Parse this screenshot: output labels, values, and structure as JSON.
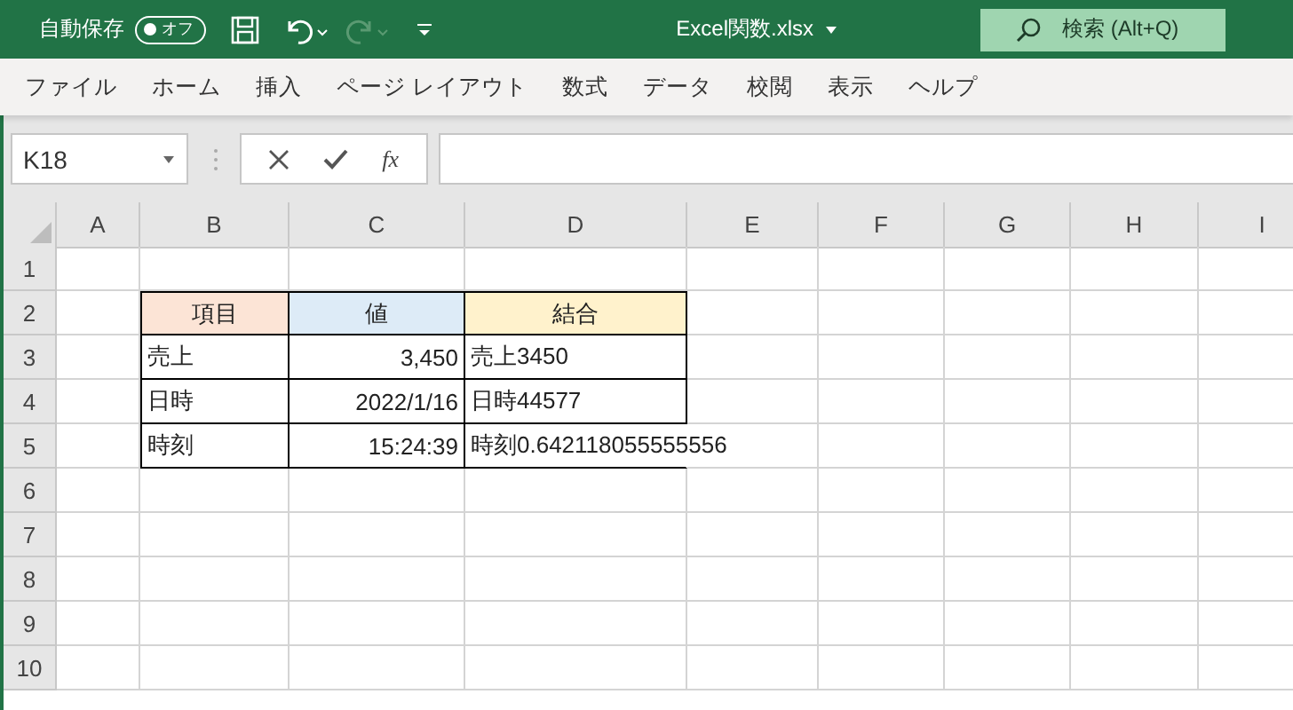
{
  "title_bar": {
    "autosave_label": "自動保存",
    "autosave": {
      "label": "オフ",
      "on": false
    },
    "file_name": "Excel関数.xlsx",
    "search": {
      "placeholder": "検索 (Alt+Q)"
    }
  },
  "ribbon_tabs": [
    {
      "label": "ファイル"
    },
    {
      "label": "ホーム"
    },
    {
      "label": "挿入"
    },
    {
      "label": "ページ レイアウト"
    },
    {
      "label": "数式"
    },
    {
      "label": "データ"
    },
    {
      "label": "校閲"
    },
    {
      "label": "表示"
    },
    {
      "label": "ヘルプ"
    }
  ],
  "formula_bar": {
    "name_box": "K18",
    "function_button": "fx"
  },
  "sheet": {
    "columns": [
      "A",
      "B",
      "C",
      "D",
      "E",
      "F",
      "G",
      "H",
      "I"
    ],
    "rows": [
      {
        "number": "1",
        "cells": []
      },
      {
        "number": "2",
        "cells": [
          {},
          {
            "kind": "header",
            "text": "項目",
            "color": "#fce4d6"
          },
          {
            "kind": "header",
            "text": "値",
            "color": "#ddebf7"
          },
          {
            "kind": "header",
            "text": "結合",
            "color": "#fff2cc"
          }
        ]
      },
      {
        "number": "3",
        "cells": [
          {},
          {
            "kind": "text",
            "text": "売上"
          },
          {
            "kind": "number",
            "text": "3,450"
          },
          {
            "kind": "text",
            "text": "売上3450"
          }
        ]
      },
      {
        "number": "4",
        "cells": [
          {},
          {
            "kind": "text",
            "text": "日時"
          },
          {
            "kind": "number",
            "text": "2022/1/16"
          },
          {
            "kind": "text",
            "text": "日時44577"
          }
        ]
      },
      {
        "number": "5",
        "cells": [
          {},
          {
            "kind": "text",
            "text": "時刻"
          },
          {
            "kind": "number",
            "text": "15:24:39"
          },
          {
            "kind": "text",
            "text": "時刻0.642118055555556"
          }
        ]
      },
      {
        "number": "6",
        "cells": []
      },
      {
        "number": "7",
        "cells": []
      },
      {
        "number": "8",
        "cells": []
      },
      {
        "number": "9",
        "cells": []
      },
      {
        "number": "10",
        "cells": []
      }
    ]
  }
}
